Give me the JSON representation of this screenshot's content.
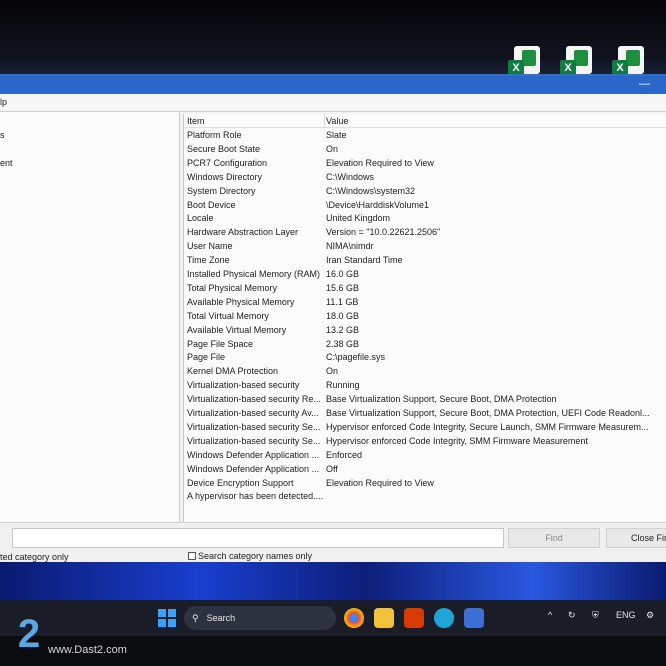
{
  "menu": {
    "partial_item": "lp"
  },
  "tree": {
    "items": [
      "s",
      "ent"
    ]
  },
  "list": {
    "headers": {
      "item": "Item",
      "value": "Value"
    },
    "rows": [
      {
        "item": "Platform Role",
        "value": "Slate"
      },
      {
        "item": "Secure Boot State",
        "value": "On"
      },
      {
        "item": "PCR7 Configuration",
        "value": "Elevation Required to View"
      },
      {
        "item": "Windows Directory",
        "value": "C:\\Windows"
      },
      {
        "item": "System Directory",
        "value": "C:\\Windows\\system32"
      },
      {
        "item": "Boot Device",
        "value": "\\Device\\HarddiskVolume1"
      },
      {
        "item": "Locale",
        "value": "United Kingdom"
      },
      {
        "item": "Hardware Abstraction Layer",
        "value": "Version = \"10.0.22621.2506\""
      },
      {
        "item": "User Name",
        "value": "NIMA\\nimdr"
      },
      {
        "item": "Time Zone",
        "value": "Iran Standard Time"
      },
      {
        "item": "Installed Physical Memory (RAM)",
        "value": "16.0 GB"
      },
      {
        "item": "Total Physical Memory",
        "value": "15.6 GB"
      },
      {
        "item": "Available Physical Memory",
        "value": "11.1 GB"
      },
      {
        "item": "Total Virtual Memory",
        "value": "18.0 GB"
      },
      {
        "item": "Available Virtual Memory",
        "value": "13.2 GB"
      },
      {
        "item": "Page File Space",
        "value": "2.38 GB"
      },
      {
        "item": "Page File",
        "value": "C:\\pagefile.sys"
      },
      {
        "item": "Kernel DMA Protection",
        "value": "On"
      },
      {
        "item": "Virtualization-based security",
        "value": "Running"
      },
      {
        "item": "Virtualization-based security Re...",
        "value": "Base Virtualization Support, Secure Boot, DMA Protection"
      },
      {
        "item": "Virtualization-based security Av...",
        "value": "Base Virtualization Support, Secure Boot, DMA Protection, UEFI Code Readonl..."
      },
      {
        "item": "Virtualization-based security Se...",
        "value": "Hypervisor enforced Code Integrity, Secure Launch, SMM Firmware Measurem..."
      },
      {
        "item": "Virtualization-based security Se...",
        "value": "Hypervisor enforced Code Integrity, SMM Firmware Measurement"
      },
      {
        "item": "Windows Defender Application ...",
        "value": "Enforced"
      },
      {
        "item": "Windows Defender Application ...",
        "value": "Off"
      },
      {
        "item": "Device Encryption Support",
        "value": "Elevation Required to View"
      },
      {
        "item": "A hypervisor has been detected....",
        "value": ""
      }
    ]
  },
  "find": {
    "find_label": "Find",
    "close_label": "Close Fir",
    "selected_category_label": "ted category only",
    "search_category_label": "Search category names only"
  },
  "taskbar": {
    "search_placeholder": "Search",
    "language": "ENG",
    "apps": [
      "chrome-icon",
      "file-explorer-icon",
      "office-icon",
      "edge-icon",
      "system-information-icon"
    ]
  },
  "watermark": {
    "logo": "2",
    "text": "www.Dast2.com"
  },
  "colors": {
    "titlebar": "#2b66c9",
    "taskbar": "#1a1d27",
    "excel_green": "#107c41"
  }
}
